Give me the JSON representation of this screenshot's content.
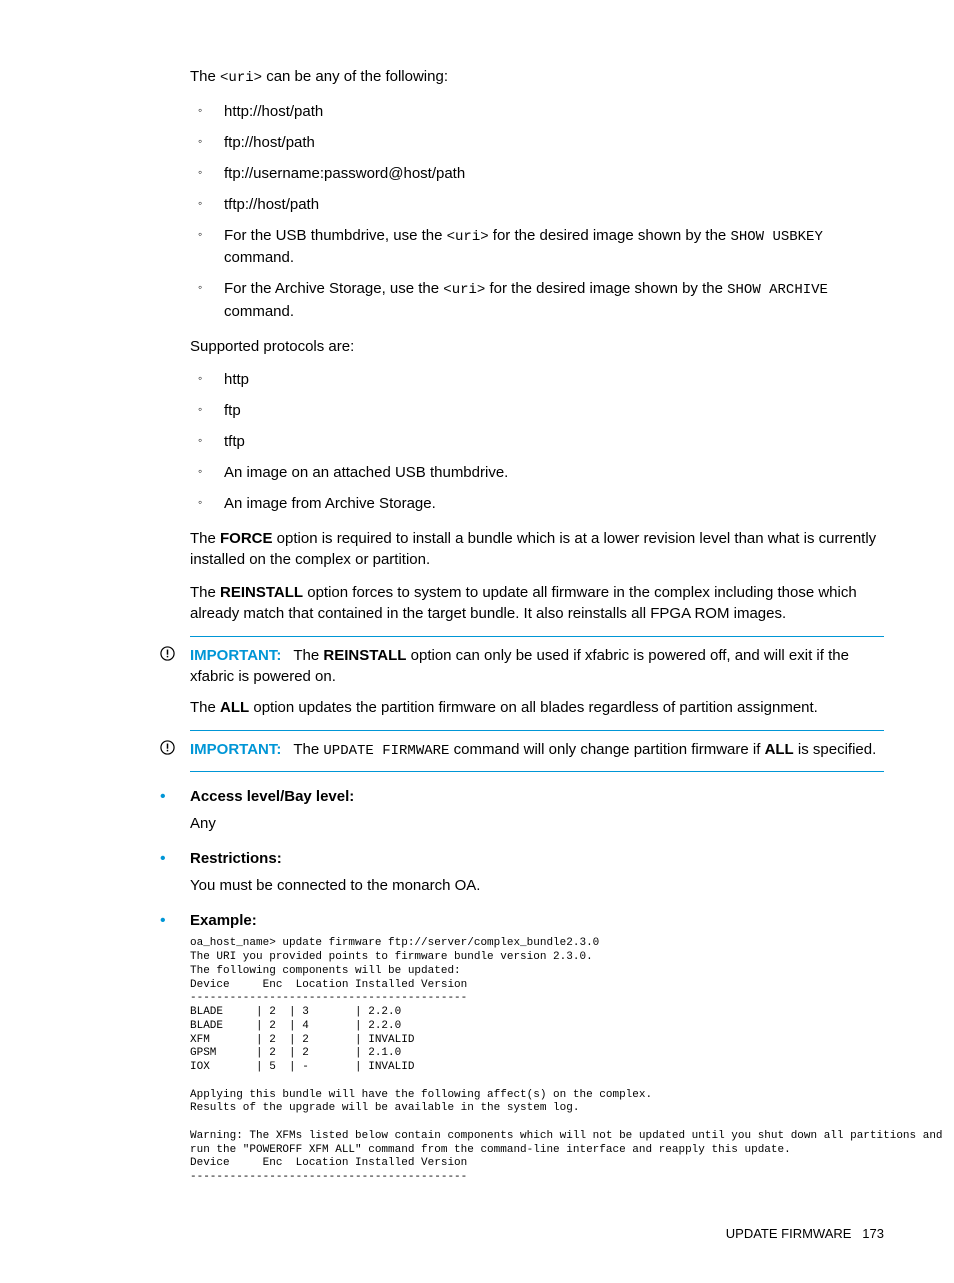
{
  "intro": {
    "prefix": "The ",
    "uri": "<uri>",
    "suffix": " can be any of the following:"
  },
  "uri_list": [
    {
      "text": "http://host/path"
    },
    {
      "text": "ftp://host/path"
    },
    {
      "text": "ftp://username:password@host/path"
    },
    {
      "text": "tftp://host/path"
    },
    {
      "prefix": "For the USB thumbdrive, use the ",
      "code1": "<uri>",
      "mid": " for the desired image shown by the ",
      "code2": "SHOW USBKEY",
      "suffix": " command."
    },
    {
      "prefix": "For the Archive Storage, use the ",
      "code1": "<uri>",
      "mid": " for the desired image shown by the ",
      "code2": "SHOW ARCHIVE",
      "suffix": " command."
    }
  ],
  "supported_label": "Supported protocols are:",
  "proto_list": [
    "http",
    "ftp",
    "tftp",
    "An image on an attached USB thumbdrive.",
    "An image from Archive Storage."
  ],
  "force_para": {
    "p1": "The ",
    "b": "FORCE",
    "p2": " option is required to install a bundle which is at a lower revision level than what is currently installed on the complex or partition."
  },
  "reinstall_para": {
    "p1": "The ",
    "b": "REINSTALL",
    "p2": " option forces to system to update all firmware in the complex including those which already match that contained in the target bundle. It also reinstalls all FPGA ROM images."
  },
  "important1": {
    "label": "IMPORTANT:",
    "p1": "The ",
    "b": "REINSTALL",
    "p2": " option can only be used if xfabric is powered off, and will exit if the xfabric is powered on."
  },
  "all_para": {
    "p1": "The ",
    "b": "ALL",
    "p2": " option updates the partition firmware on all blades regardless of partition assignment."
  },
  "important2": {
    "label": "IMPORTANT:",
    "p1": "The ",
    "code": "UPDATE FIRMWARE",
    "p2": " command will only change partition firmware if ",
    "b": "ALL",
    "p3": " is specified."
  },
  "access": {
    "head": "Access level/Bay level:",
    "body": "Any"
  },
  "restrictions": {
    "head": "Restrictions:",
    "body": "You must be connected to the monarch OA."
  },
  "example": {
    "head": "Example:",
    "code": "oa_host_name> update firmware ftp://server/complex_bundle2.3.0\nThe URI you provided points to firmware bundle version 2.3.0.\nThe following components will be updated:\nDevice     Enc  Location Installed Version\n------------------------------------------\nBLADE     | 2  | 3       | 2.2.0\nBLADE     | 2  | 4       | 2.2.0\nXFM       | 2  | 2       | INVALID\nGPSM      | 2  | 2       | 2.1.0\nIOX       | 5  | -       | INVALID\n\nApplying this bundle will have the following affect(s) on the complex.\nResults of the upgrade will be available in the system log.\n\nWarning: The XFMs listed below contain components which will not be updated until you shut down all partitions and\nrun the \"POWEROFF XFM ALL\" command from the command-line interface and reapply this update.\nDevice     Enc  Location Installed Version\n------------------------------------------"
  },
  "footer": {
    "title": "UPDATE FIRMWARE",
    "page": "173"
  }
}
